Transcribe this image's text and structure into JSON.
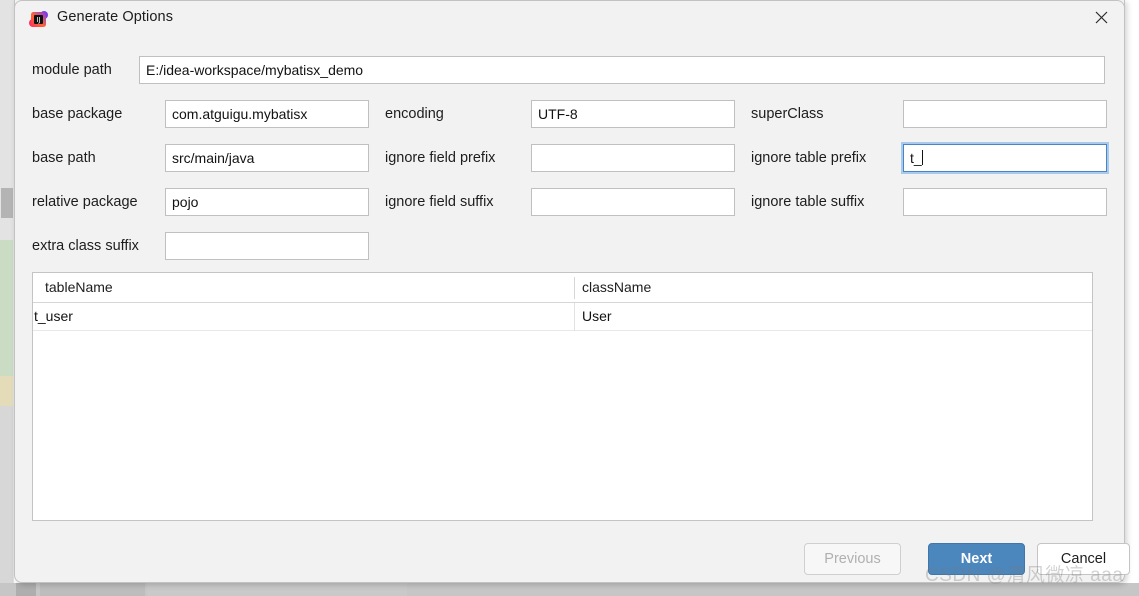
{
  "window": {
    "title": "Generate Options",
    "app_icon": "intellij-idea-icon",
    "close_icon": "close-icon"
  },
  "form": {
    "module_path": {
      "label": "module path",
      "value": "E:/idea-workspace/mybatisx_demo"
    },
    "rows": [
      {
        "left": {
          "label": "base package",
          "value": "com.atguigu.mybatisx",
          "focused": false
        },
        "middle": {
          "label": "encoding",
          "value": "UTF-8",
          "focused": false
        },
        "right": {
          "label": "superClass",
          "value": "",
          "focused": false
        }
      },
      {
        "left": {
          "label": "base path",
          "value": "src/main/java",
          "focused": false
        },
        "middle": {
          "label": "ignore field prefix",
          "value": "",
          "focused": false
        },
        "right": {
          "label": "ignore table prefix",
          "value": "t_",
          "focused": true
        }
      },
      {
        "left": {
          "label": "relative package",
          "value": "pojo",
          "focused": false
        },
        "middle": {
          "label": "ignore field suffix",
          "value": "",
          "focused": false
        },
        "right": {
          "label": "ignore table suffix",
          "value": "",
          "focused": false
        }
      },
      {
        "left": {
          "label": "extra class suffix",
          "value": "",
          "focused": false
        }
      }
    ]
  },
  "table": {
    "columns": [
      "tableName",
      "className"
    ],
    "rows": [
      {
        "tableName": "t_user",
        "className": "User"
      }
    ]
  },
  "footer": {
    "previous_label": "Previous",
    "next_label": "Next",
    "cancel_label": "Cancel"
  },
  "watermark": {
    "text": "CSDN @清风微凉 aaa"
  },
  "colors": {
    "dialog_background": "#f2f2f2",
    "primary_button": "#4b86bd",
    "focus_ring": "#a8cbec",
    "field_border": "#c0c0c0",
    "text": "#1d1d1d",
    "disabled_text": "#b0b0b0"
  }
}
